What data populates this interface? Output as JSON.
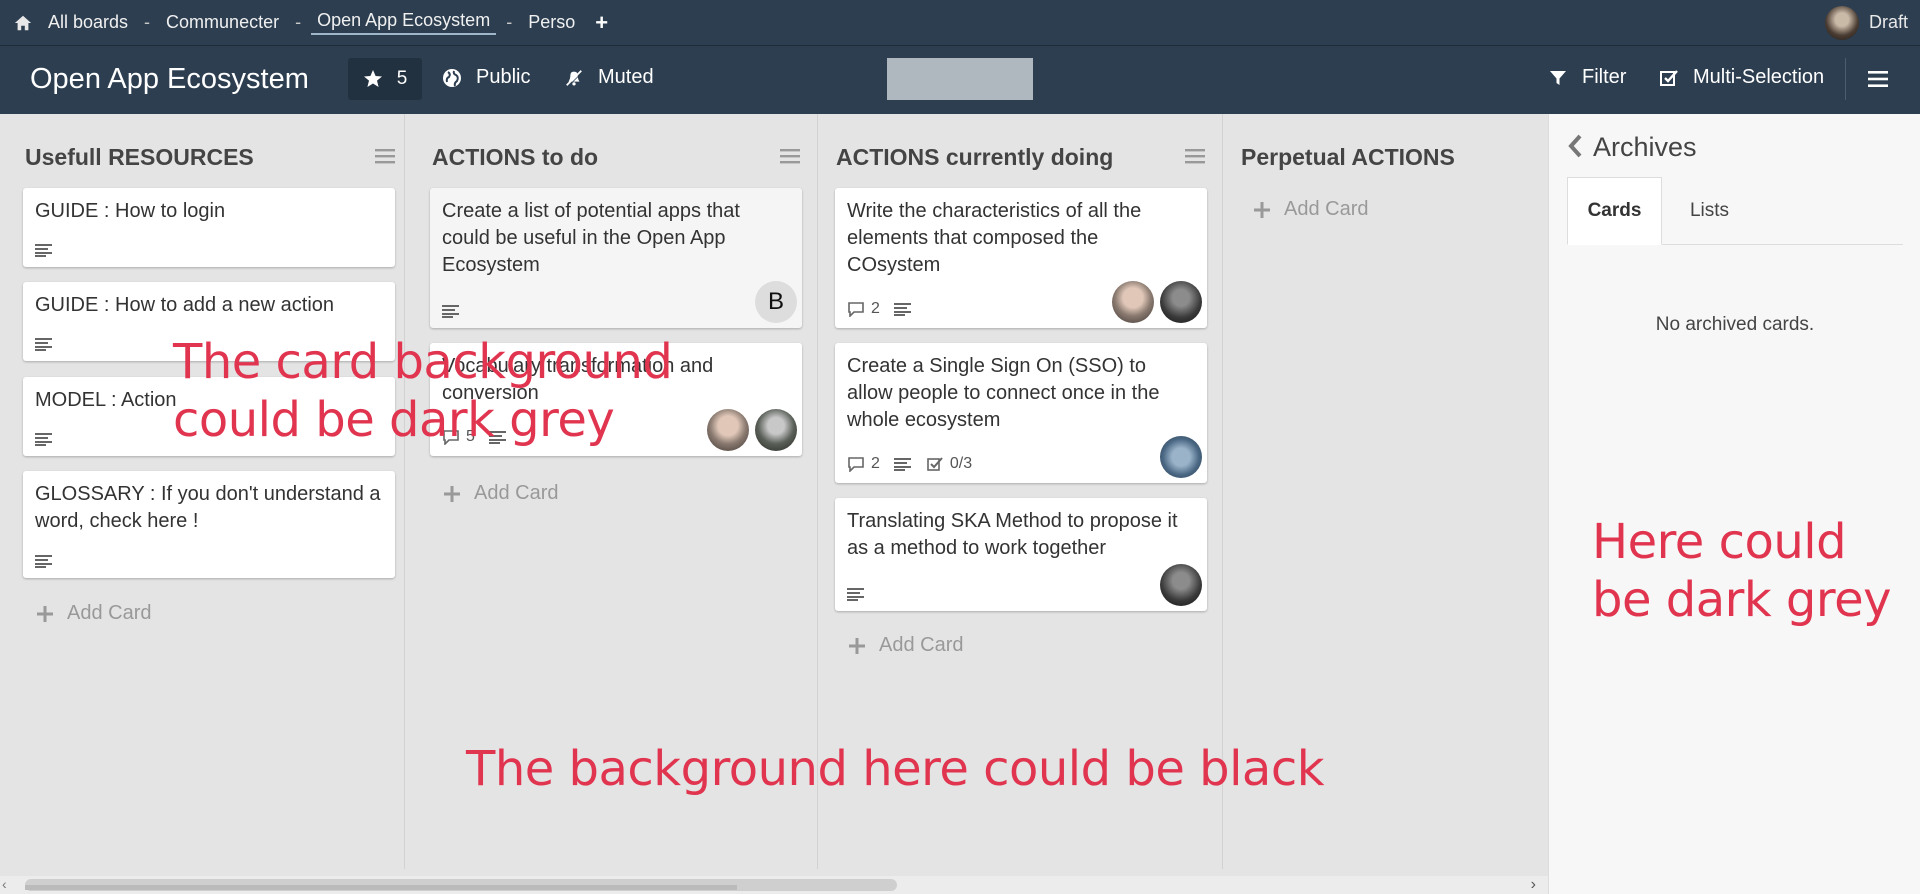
{
  "topnav": {
    "breadcrumbs": [
      "All boards",
      "Communecter",
      "Open App Ecosystem",
      "Perso"
    ],
    "separator": "-",
    "user_name": "Draft"
  },
  "board": {
    "title": "Open App Ecosystem",
    "stars": "5",
    "visibility": "Public",
    "watch": "Muted",
    "filter_label": "Filter",
    "multiselect_label": "Multi-Selection"
  },
  "lists": [
    {
      "title": "Usefull RESOURCES",
      "cards": [
        {
          "title": "GUIDE : How to login"
        },
        {
          "title": "GUIDE : How to add a new action"
        },
        {
          "title": "MODEL : Action"
        },
        {
          "title": "GLOSSARY : If you don't understand a word, check here !"
        }
      ],
      "add_card": "Add Card"
    },
    {
      "title": "ACTIONS to do",
      "cards": [
        {
          "title": "Create a list of potential apps that could be useful in the Open App Ecosystem",
          "member_letter": "B"
        },
        {
          "title": "Vocabulary transformation and conversion",
          "comments": "5"
        }
      ],
      "add_card": "Add Card"
    },
    {
      "title": "ACTIONS currently doing",
      "cards": [
        {
          "title": "Write the characteristics of all the elements that composed the COsystem",
          "comments": "2"
        },
        {
          "title": "Create a Single Sign On (SSO) to allow people to connect once in the whole ecosystem",
          "comments": "2",
          "checklist": "0/3"
        },
        {
          "title": "Translating SKA Method to propose it as a method to work together"
        }
      ],
      "add_card": "Add Card"
    },
    {
      "title": "Perpetual ACTIONS",
      "cards": [],
      "add_card": "Add Card"
    }
  ],
  "sidebar": {
    "title": "Archives",
    "tabs": [
      "Cards",
      "Lists"
    ],
    "empty_text": "No archived cards."
  },
  "annotations": {
    "card_bg": "The card background could be dark grey",
    "sidebar_bg": "Here could be dark grey",
    "board_bg": "The background here could be black"
  },
  "colors": {
    "header_bg": "#2c3e50",
    "board_bg": "#e4e4e4",
    "annotation": "#e0344f"
  }
}
